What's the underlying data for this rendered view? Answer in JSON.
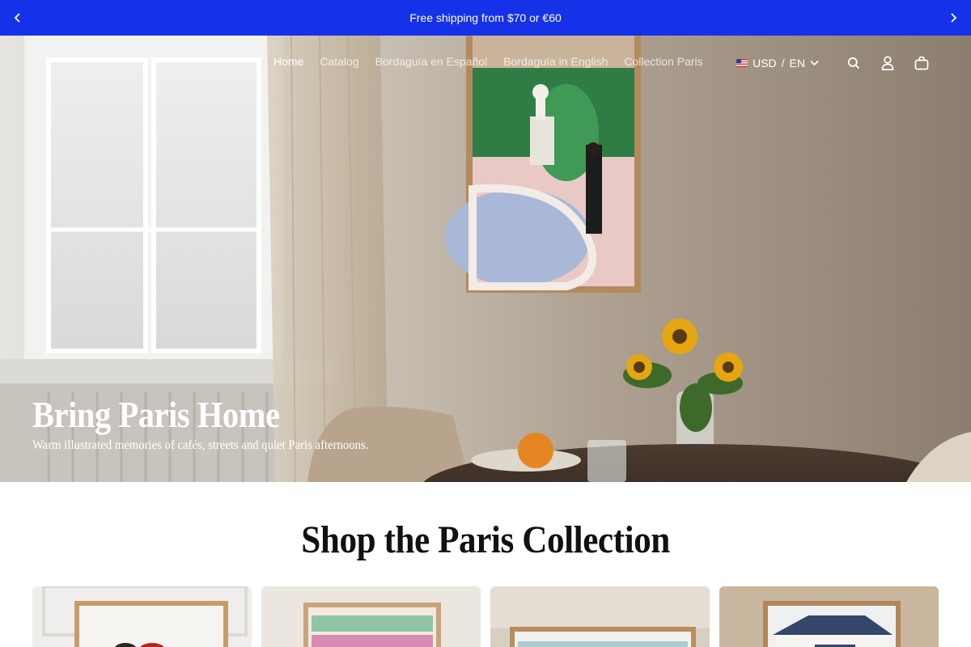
{
  "announcement": {
    "text": "Free shipping from $70 or €60",
    "prev_icon": "chevron-left-icon",
    "next_icon": "chevron-right-icon"
  },
  "nav": {
    "links": [
      {
        "label": "Home",
        "active": true
      },
      {
        "label": "Catalog",
        "active": false
      },
      {
        "label": "Bordaguía en Español",
        "active": false
      },
      {
        "label": "Bordaguía in English",
        "active": false
      },
      {
        "label": "Collection Paris",
        "active": false
      }
    ],
    "locale": {
      "currency": "USD",
      "separator": "/",
      "language": "EN"
    },
    "icons": [
      "search-icon",
      "account-icon",
      "cart-icon"
    ]
  },
  "hero": {
    "title": "Bring Paris Home",
    "subtitle": "Warm illustrated memories of cafés, streets and quiet Paris afternoons."
  },
  "collection": {
    "title": "Shop the Paris Collection"
  },
  "colors": {
    "announcement_bg": "#1632e8",
    "text_dark": "#111111"
  }
}
